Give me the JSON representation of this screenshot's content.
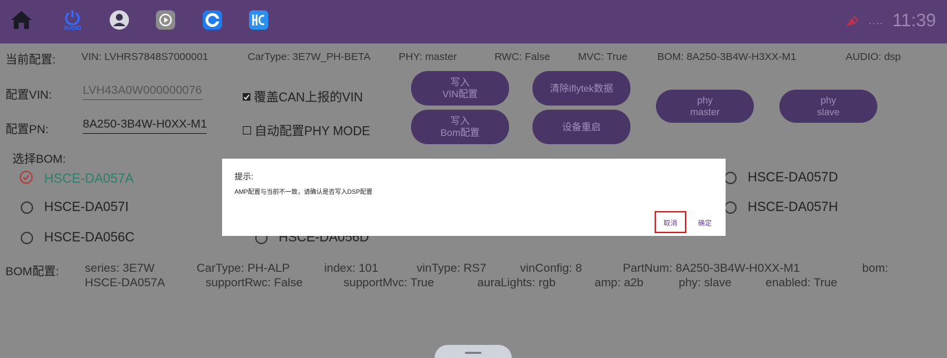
{
  "topbar": {
    "icons": [
      "home-icon",
      "power-audio-icon",
      "user-icon",
      "media-play-icon",
      "app-c-icon",
      "app-hc-icon"
    ],
    "audio_label": "AUDIO",
    "signal_dots": "....",
    "time": "11:39"
  },
  "current_config": {
    "label": "当前配置:",
    "vin": "VIN: LVHRS7848S7000001",
    "cartype": "CarType: 3E7W_PH-BETA",
    "phy": "PHY: master",
    "rwc": "RWC: False",
    "mvc": "MVC: True",
    "bom": "BOM: 8A250-3B4W-H3XX-M1",
    "audio": "AUDIO: dsp"
  },
  "config_vin": {
    "label": "配置VIN:",
    "value": "LVH43A0W000000076"
  },
  "config_pn": {
    "label": "配置PN:",
    "value": "8A250-3B4W-H0XX-M1"
  },
  "checkboxes": {
    "override_vin": "覆盖CAN上报的VIN",
    "auto_phy": "自动配置PHY MODE"
  },
  "buttons": {
    "write_vin_l1": "写入",
    "write_vin_l2": "VIN配置",
    "clear_iflytek": "清除iflytek数据",
    "write_bom_l1": "写入",
    "write_bom_l2": "Bom配置",
    "reboot": "设备重启",
    "phy_master_l1": "phy",
    "phy_master_l2": "master",
    "phy_slave_l1": "phy",
    "phy_slave_l2": "slave"
  },
  "bom_select": {
    "label": "选择BOM:",
    "options": [
      "HSCE-DA057A",
      "HSCE-DA057I",
      "HSCE-DA056C",
      "HSCE-DA056D",
      "HSCE-DA057D",
      "HSCE-DA057H"
    ],
    "selected": "HSCE-DA057A"
  },
  "bom_config": {
    "label": "BOM配置:",
    "row1": [
      "series: 3E7W",
      "CarType: PH-ALP",
      "index: 101",
      "vinType: RS7",
      "vinConfig: 8",
      "PartNum: 8A250-3B4W-H0XX-M1",
      "bom:"
    ],
    "row2": [
      "HSCE-DA057A",
      "supportRwc: False",
      "supportMvc: True",
      "auraLights: rgb",
      "amp: a2b",
      "phy: slave",
      "enabled: True"
    ]
  },
  "dialog": {
    "title": "提示:",
    "message": "AMP配置与当前不一致，请确认是否写入DSP配置",
    "cancel": "取消",
    "confirm": "确定"
  },
  "colors": {
    "topbar": "#593e76",
    "selected_option": "#2f7d6c",
    "selected_icon": "#b04040",
    "highlight_border": "#e02020",
    "dialog_button_text": "#6a3aa2"
  }
}
